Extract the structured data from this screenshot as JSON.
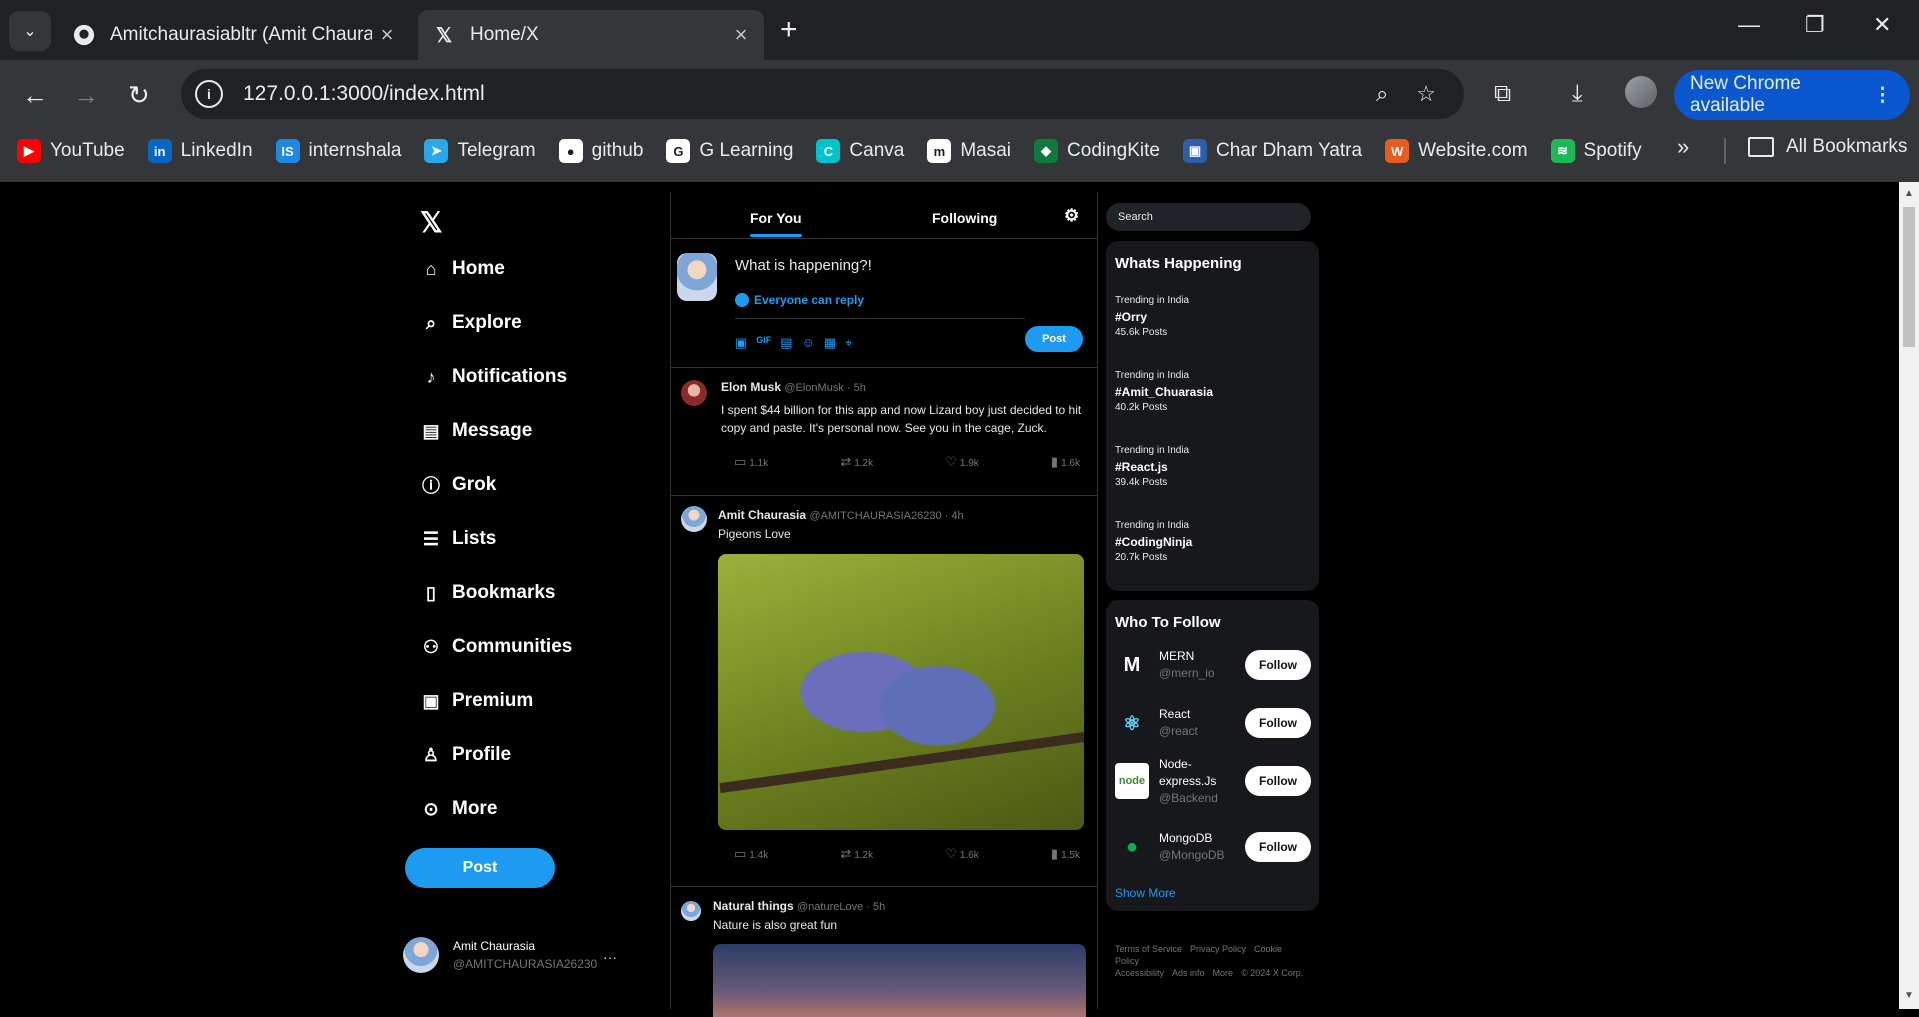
{
  "browser": {
    "tabs": [
      {
        "title": "Amitchaurasiabltr (Amit Chaura",
        "favicon": "github-icon",
        "active": false
      },
      {
        "title": "Home/X",
        "favicon": "x-icon",
        "active": true
      }
    ],
    "url": "127.0.0.1:3000/index.html",
    "update_label": "New Chrome available",
    "bookmarks": [
      {
        "label": "YouTube",
        "icon": "youtube-icon",
        "color": "#ff0000"
      },
      {
        "label": "LinkedIn",
        "icon": "linkedin-icon",
        "color": "#0a66c2"
      },
      {
        "label": "internshala",
        "icon": "internshala-icon",
        "color": "#1e88e5"
      },
      {
        "label": "Telegram",
        "icon": "telegram-icon",
        "color": "#29a9eb"
      },
      {
        "label": "github",
        "icon": "github-icon",
        "color": "#ffffff"
      },
      {
        "label": "G Learning",
        "icon": "google-icon",
        "color": "#ffffff"
      },
      {
        "label": "Canva",
        "icon": "canva-icon",
        "color": "#00c4cc"
      },
      {
        "label": "Masai",
        "icon": "masai-icon",
        "color": "#ffffff"
      },
      {
        "label": "CodingKite",
        "icon": "codingkite-icon",
        "color": "#0f7a3b"
      },
      {
        "label": "Char Dham Yatra",
        "icon": "chardham-icon",
        "color": "#2d5fa8"
      },
      {
        "label": "Website.com",
        "icon": "website-icon",
        "color": "#e85d1f"
      },
      {
        "label": "Spotify",
        "icon": "spotify-icon",
        "color": "#1db954"
      }
    ],
    "all_bookmarks": "All Bookmarks"
  },
  "nav": {
    "items": [
      {
        "label": "Home",
        "icon": "home-icon"
      },
      {
        "label": "Explore",
        "icon": "search-icon"
      },
      {
        "label": "Notifications",
        "icon": "bell-icon"
      },
      {
        "label": "Message",
        "icon": "message-icon"
      },
      {
        "label": "Grok",
        "icon": "info-icon"
      },
      {
        "label": "Lists",
        "icon": "list-icon"
      },
      {
        "label": "Bookmarks",
        "icon": "bookmark-icon"
      },
      {
        "label": "Communities",
        "icon": "communities-icon"
      },
      {
        "label": "Premium",
        "icon": "premium-icon"
      },
      {
        "label": "Profile",
        "icon": "profile-icon"
      },
      {
        "label": "More",
        "icon": "more-icon"
      }
    ],
    "post_label": "Post",
    "user": {
      "name": "Amit Chaurasia",
      "handle": "@AMITCHAURASIA26230"
    }
  },
  "feed": {
    "tabs": [
      "For You",
      "Following"
    ],
    "composer": {
      "placeholder": "What is happening?!",
      "reply_label": "Everyone can reply",
      "post_label": "Post"
    },
    "tweets": [
      {
        "name": "Elon Musk",
        "meta": "@ElonMusk · 5h",
        "text": "I spent $44 billion for this app and now Lizard boy just decided to hit copy and paste. It's personal now. See you in the cage, Zuck.",
        "replies": "1.1k",
        "retweets": "1.2k",
        "likes": "1.9k",
        "views": "1.6k"
      },
      {
        "name": "Amit Chaurasia",
        "meta": "@AMITCHAURASIA26230 · 4h",
        "text": "Pigeons Love",
        "replies": "1.4k",
        "retweets": "1.2k",
        "likes": "1.6k",
        "views": "1.5k"
      },
      {
        "name": "Natural things",
        "meta": "@natureLove · 5h",
        "text": "Nature is also great fun"
      }
    ]
  },
  "sidebar": {
    "search_placeholder": "Search",
    "trends_title": "Whats Happening",
    "trends": [
      {
        "context": "Trending in India",
        "tag": "#Orry",
        "count": "45.6k Posts"
      },
      {
        "context": "Trending in India",
        "tag": "#Amit_Chuarasia",
        "count": "40.2k Posts"
      },
      {
        "context": "Trending in India",
        "tag": "#React.js",
        "count": "39.4k Posts"
      },
      {
        "context": "Trending in India",
        "tag": "#CodingNinja",
        "count": "20.7k Posts"
      }
    ],
    "follow_title": "Who To Follow",
    "accounts": [
      {
        "name": "MERN",
        "handle": "@mern_io",
        "logo": "M"
      },
      {
        "name": "React",
        "handle": "@react",
        "logo": "⚛"
      },
      {
        "name": "Node-express.Js",
        "handle": "@Backend",
        "logo": "node"
      },
      {
        "name": "MongoDB",
        "handle": "@MongoDB",
        "logo": "●"
      }
    ],
    "follow_label": "Follow",
    "show_more": "Show More",
    "footer": [
      "Terms of Service",
      "Privacy Policy",
      "Cookie Policy",
      "Accessibility",
      "Ads info",
      "More",
      "© 2024 X Corp."
    ]
  }
}
